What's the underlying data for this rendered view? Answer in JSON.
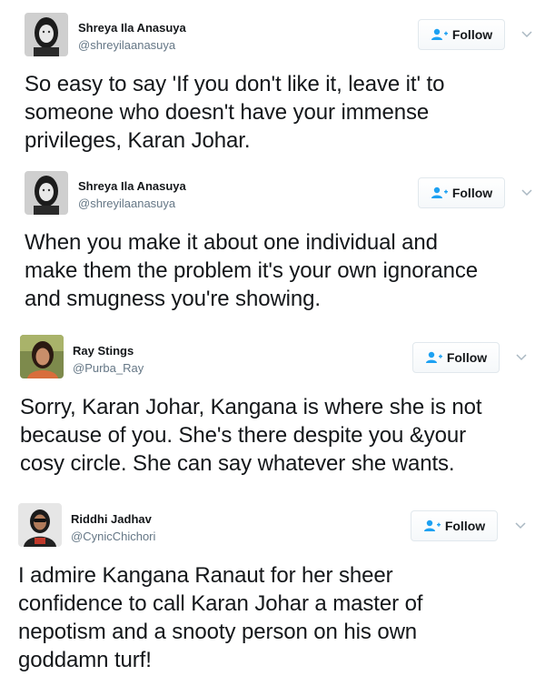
{
  "tweets": [
    {
      "name": "Shreya Ila Anasuya",
      "handle": "@shreyilaanasuya",
      "follow_label": "Follow",
      "avatar_icon": "user-avatar-photo",
      "text": "So easy to say 'If you don't like it, leave it' to\nsomeone who doesn't have your immense\nprivileges, Karan Johar."
    },
    {
      "name": "Shreya Ila Anasuya",
      "handle": "@shreyilaanasuya",
      "follow_label": "Follow",
      "avatar_icon": "user-avatar-photo",
      "text": "When you make it about one individual and\nmake them the problem it's your own ignorance\nand smugness you're showing."
    },
    {
      "name": "Ray Stings",
      "handle": "@Purba_Ray",
      "follow_label": "Follow",
      "avatar_icon": "user-avatar-photo",
      "text": "Sorry, Karan Johar, Kangana is where she is not\nbecause of you. She's there despite you &your\ncosy circle. She can say whatever she wants."
    },
    {
      "name": "Riddhi Jadhav",
      "handle": "@CynicChichori",
      "follow_label": "Follow",
      "avatar_icon": "user-avatar-photo",
      "text": "I admire Kangana Ranaut for her sheer\nconfidence to call Karan Johar a master of\nnepotism and a snooty person on his own\ngoddamn turf!"
    }
  ],
  "colors": {
    "follow_icon": "#1da1f2",
    "handle": "#657786",
    "text": "#14171a"
  }
}
